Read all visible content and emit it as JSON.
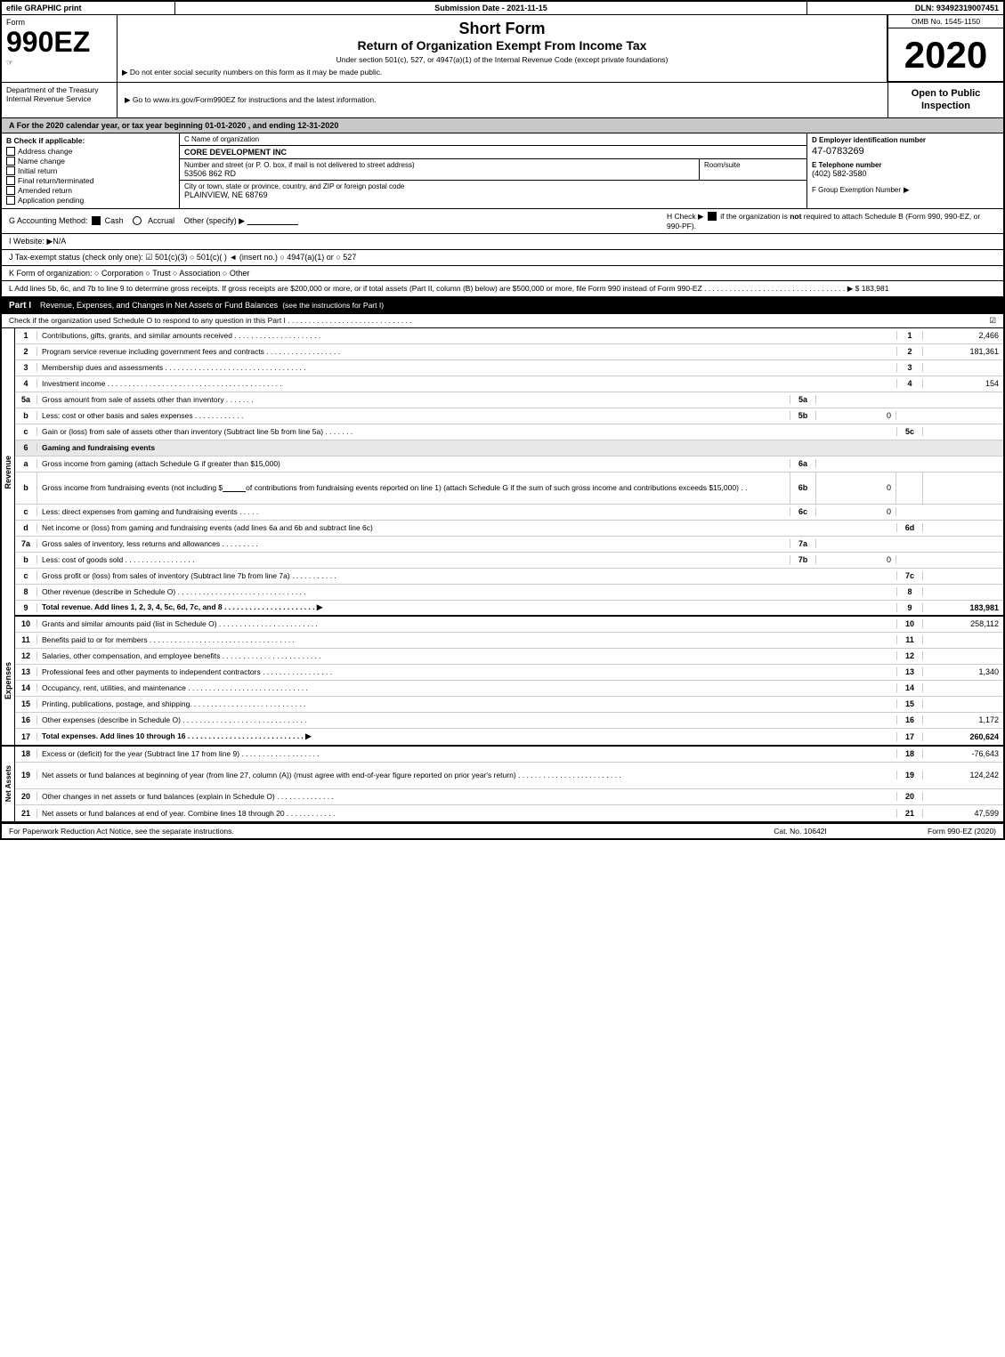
{
  "topBar": {
    "leftLabel": "efile GRAPHIC print",
    "midLabel": "Submission Date - 2021-11-15",
    "rightLabel": "DLN: 93492319007451"
  },
  "ombNo": "OMB No. 1545-1150",
  "formNumber": "990EZ",
  "formSubLabel": "Form",
  "sideNote": "☞",
  "titleShort": "Short Form",
  "titleFull": "Return of Organization Exempt From Income Tax",
  "subtitle501": "Under section 501(c), 527, or 4947(a)(1) of the Internal Revenue Code (except private foundations)",
  "noSSN": "▶ Do not enter social security numbers on this form as it may be made public.",
  "goTo": "▶ Go to www.irs.gov/Form990EZ for instructions and the latest information.",
  "year": "2020",
  "openToPublic": "Open to Public Inspection",
  "deptLabel": "Department of the Treasury Internal Revenue Service",
  "taxYearLine": "A For the 2020 calendar year, or tax year beginning 01-01-2020 , and ending 12-31-2020",
  "checkIfApplicable": "B Check if applicable:",
  "addressChange": "Address change",
  "nameChange": "Name change",
  "initialReturn": "Initial return",
  "finalReturn": "Final return/terminated",
  "amendedReturn": "Amended return",
  "applicationPending": "Application pending",
  "orgNameLabel": "C Name of organization",
  "orgName": "CORE DEVELOPMENT INC",
  "streetLabel": "Number and street (or P. O. box, if mail is not delivered to street address)",
  "streetValue": "53506 862 RD",
  "roomSuiteLabel": "Room/suite",
  "cityLabel": "City or town, state or province, country, and ZIP or foreign postal code",
  "cityValue": "PLAINVIEW, NE  68769",
  "einLabel": "D Employer identification number",
  "einValue": "47-0783269",
  "phoneLabel": "E Telephone number",
  "phoneValue": "(402) 582-3580",
  "groupExLabel": "F Group Exemption Number",
  "groupExArrow": "▶",
  "accountingMethod": "G Accounting Method:",
  "cashChecked": true,
  "accrualChecked": false,
  "otherSpecify": "Other (specify) ▶ _______________",
  "hCheck": "H Check ▶ ☑ if the organization is not required to attach Schedule B (Form 990, 990-EZ, or 990-PF).",
  "website": "I Website: ▶N/A",
  "taxStatus": "J Tax-exempt status (check only one): ☑ 501(c)(3) ○ 501(c)( ) ◄ (insert no.) ○ 4947(a)(1) or ○ 527",
  "formOrg": "K Form of organization:  ○ Corporation   ○ Trust   ○ Association   ○ Other",
  "grossReceipts": "L Add lines 5b, 6c, and 7b to line 9 to determine gross receipts. If gross receipts are $200,000 or more, or if total assets (Part II, column (B) below) are $500,000 or more, file Form 990 instead of Form 990-EZ . . . . . . . . . . . . . . . . . . . . . . . . . . . . . . . . . . ▶ $ 183,981",
  "partI": {
    "label": "Part I",
    "title": "Revenue, Expenses, and Changes in Net Assets or Fund Balances",
    "titleNote": "(see the instructions for Part I)",
    "checkLine": "Check if the organization used Schedule O to respond to any question in this Part I . . . . . . . . . . . . . . . . . . . . . . . . . . . . . .",
    "checkValue": "☑",
    "rows": [
      {
        "num": "1",
        "desc": "Contributions, gifts, grants, and similar amounts received . . . . . . . . . . . . . . . . . . . . .",
        "lineNum": "1",
        "value": "2,466",
        "shaded": false
      },
      {
        "num": "2",
        "desc": "Program service revenue including government fees and contracts . . . . . . . . . . . . . . . . . .",
        "lineNum": "2",
        "value": "181,361",
        "shaded": false
      },
      {
        "num": "3",
        "desc": "Membership dues and assessments . . . . . . . . . . . . . . . . . . . . . . . . . . . . . . . . . .",
        "lineNum": "3",
        "value": "",
        "shaded": false
      },
      {
        "num": "4",
        "desc": "Investment income . . . . . . . . . . . . . . . . . . . . . . . . . . . . . . . . . . . . . . . . . .",
        "lineNum": "4",
        "value": "154",
        "shaded": false
      },
      {
        "num": "5a",
        "desc": "Gross amount from sale of assets other than inventory . . . . . . .",
        "subLabel": "5a",
        "subValue": "",
        "lineNum": "",
        "value": "",
        "shaded": false,
        "hasSub": true
      },
      {
        "num": "b",
        "desc": "Less: cost or other basis and sales expenses . . . . . . . . . . . .",
        "subLabel": "5b",
        "subValue": "0",
        "lineNum": "",
        "value": "",
        "shaded": false,
        "hasSub": true
      },
      {
        "num": "c",
        "desc": "Gain or (loss) from sale of assets other than inventory (Subtract line 5b from line 5a) . . . . . . .",
        "lineNum": "5c",
        "value": "",
        "shaded": false
      },
      {
        "num": "6",
        "desc": "Gaming and fundraising events",
        "lineNum": "",
        "value": "",
        "shaded": false
      },
      {
        "num": "a",
        "desc": "Gross income from gaming (attach Schedule G if greater than $15,000)",
        "subLabel": "6a",
        "subValue": "",
        "lineNum": "",
        "value": "",
        "shaded": false,
        "hasSub": true
      },
      {
        "num": "b",
        "desc": "Gross income from fundraising events (not including $ _____________ of contributions from fundraising events reported on line 1) (attach Schedule G if the sum of such gross income and contributions exceeds $15,000)  .  .",
        "subLabel": "6b",
        "subValue": "0",
        "lineNum": "",
        "value": "",
        "shaded": false,
        "hasSub": true
      },
      {
        "num": "c",
        "desc": "Less: direct expenses from gaming and fundraising events    .    .    .    .    .",
        "subLabel": "6c",
        "subValue": "0",
        "lineNum": "",
        "value": "",
        "shaded": false,
        "hasSub": true
      },
      {
        "num": "d",
        "desc": "Net income or (loss) from gaming and fundraising events (add lines 6a and 6b and subtract line 6c)",
        "lineNum": "6d",
        "value": "",
        "shaded": false
      },
      {
        "num": "7a",
        "desc": "Gross sales of inventory, less returns and allowances . . . . . . . . .",
        "subLabel": "7a",
        "subValue": "",
        "lineNum": "",
        "value": "",
        "shaded": false,
        "hasSub": true
      },
      {
        "num": "b",
        "desc": "Less: cost of goods sold     .    .    .    .    .    .    .    .    .    .    .    .    .    .    .    .    .",
        "subLabel": "7b",
        "subValue": "0",
        "lineNum": "",
        "value": "",
        "shaded": false,
        "hasSub": true
      },
      {
        "num": "c",
        "desc": "Gross profit or (loss) from sales of inventory (Subtract line 7b from line 7a) . . . . . . . . . . .",
        "lineNum": "7c",
        "value": "",
        "shaded": false
      },
      {
        "num": "8",
        "desc": "Other revenue (describe in Schedule O) . . . . . . . . . . . . . . . . . . . . . . . . . . . . . . .",
        "lineNum": "8",
        "value": "",
        "shaded": false
      },
      {
        "num": "9",
        "desc": "Total revenue. Add lines 1, 2, 3, 4, 5c, 6d, 7c, and 8 . . . . . . . . . . . . . . . . . . . . . . ▶",
        "lineNum": "9",
        "value": "183,981",
        "shaded": false,
        "bold": true
      }
    ]
  },
  "expenses": {
    "rows": [
      {
        "num": "10",
        "desc": "Grants and similar amounts paid (list in Schedule O) . . . . . . . . . . . . . . . . . . . . . . . .",
        "lineNum": "10",
        "value": "258,112"
      },
      {
        "num": "11",
        "desc": "Benefits paid to or for members  . . . . . . . . . . . . . . . . . . . . . . . . . . . . . . . . . . .",
        "lineNum": "11",
        "value": ""
      },
      {
        "num": "12",
        "desc": "Salaries, other compensation, and employee benefits . . . . . . . . . . . . . . . . . . . . . . . .",
        "lineNum": "12",
        "value": ""
      },
      {
        "num": "13",
        "desc": "Professional fees and other payments to independent contractors . . . . . . . . . . . . . . . . .",
        "lineNum": "13",
        "value": "1,340"
      },
      {
        "num": "14",
        "desc": "Occupancy, rent, utilities, and maintenance . . . . . . . . . . . . . . . . . . . . . . . . . . . . .",
        "lineNum": "14",
        "value": ""
      },
      {
        "num": "15",
        "desc": "Printing, publications, postage, and shipping. . . . . . . . . . . . . . . . . . . . . . . . . . . .",
        "lineNum": "15",
        "value": ""
      },
      {
        "num": "16",
        "desc": "Other expenses (describe in Schedule O) . . . . . . . . . . . . . . . . . . . . . . . . . . . . . .",
        "lineNum": "16",
        "value": "1,172"
      },
      {
        "num": "17",
        "desc": "Total expenses. Add lines 10 through 16   . . . . . . . . . . . . . . . . . . . . . . . . . . . . ▶",
        "lineNum": "17",
        "value": "260,624",
        "bold": true
      }
    ]
  },
  "netAssets": {
    "rows": [
      {
        "num": "18",
        "desc": "Excess or (deficit) for the year (Subtract line 17 from line 9) . . . . . . . . . . . . . . . . . . .",
        "lineNum": "18",
        "value": "-76,643"
      },
      {
        "num": "19",
        "desc": "Net assets or fund balances at beginning of year (from line 27, column (A)) (must agree with end-of-year figure reported on prior year's return) . . . . . . . . . . . . . . . . . . . . . . . . .",
        "lineNum": "19",
        "value": "124,242"
      },
      {
        "num": "20",
        "desc": "Other changes in net assets or fund balances (explain in Schedule O) . . . . . . . . . . . . . .",
        "lineNum": "20",
        "value": ""
      },
      {
        "num": "21",
        "desc": "Net assets or fund balances at end of year. Combine lines 18 through 20 . . . . . . . . . . . .",
        "lineNum": "21",
        "value": "47,599"
      }
    ]
  },
  "footer": {
    "paperworkLabel": "For Paperwork Reduction Act Notice, see the separate instructions.",
    "catNo": "Cat. No. 10642I",
    "formRef": "Form 990-EZ (2020)"
  }
}
